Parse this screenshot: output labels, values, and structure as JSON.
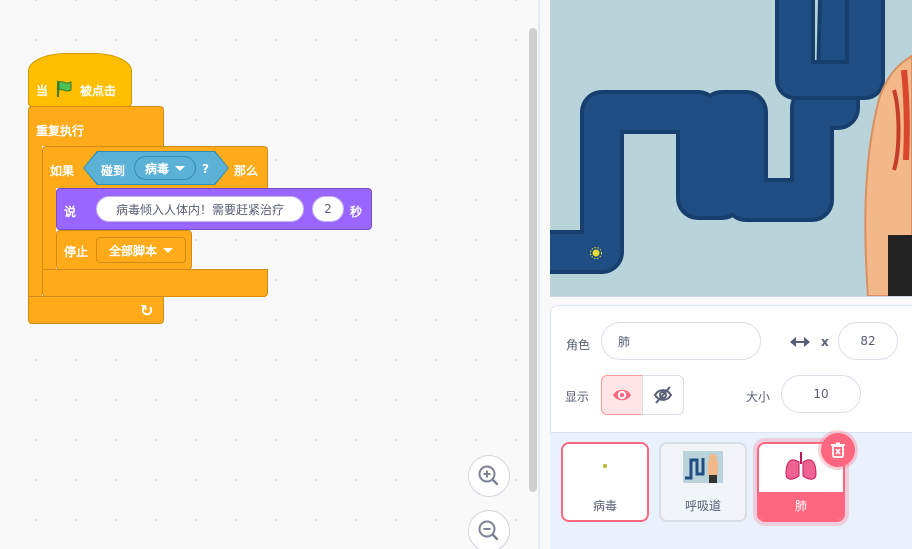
{
  "workspace": {
    "event_block": {
      "prefix": "当",
      "suffix": "被点击",
      "flag_icon": "green-flag-icon",
      "color": "#ffbf00"
    },
    "repeat_block": {
      "label": "重复执行",
      "color": "#ffab19"
    },
    "if_block": {
      "if_label": "如果",
      "then_label": "那么"
    },
    "sensing_block": {
      "label": "碰到",
      "menu_value": "病毒",
      "question": "?",
      "color": "#5cb1d6"
    },
    "say_block": {
      "label": "说",
      "message": "病毒倾入人体内！需要赶紧治疗",
      "seconds": "2",
      "seconds_unit": "秒",
      "color": "#9966ff"
    },
    "stop_block": {
      "label": "停止",
      "option": "全部脚本"
    },
    "zoom": {
      "in_icon": "zoom-in-icon",
      "out_icon": "zoom-out-icon"
    }
  },
  "sprite_info": {
    "sprite_label": "角色",
    "sprite_name": "肺",
    "x_label": "x",
    "x_value": "82",
    "show_label": "显示",
    "size_label": "大小",
    "size_value": "10"
  },
  "sprites": [
    {
      "name": "病毒",
      "selected": false
    },
    {
      "name": "呼吸道",
      "selected": false
    },
    {
      "name": "肺",
      "selected": true
    }
  ],
  "colors": {
    "accent": "#ff6680",
    "stage_bg": "#b8d3d9",
    "maze": "#1f4e82"
  }
}
